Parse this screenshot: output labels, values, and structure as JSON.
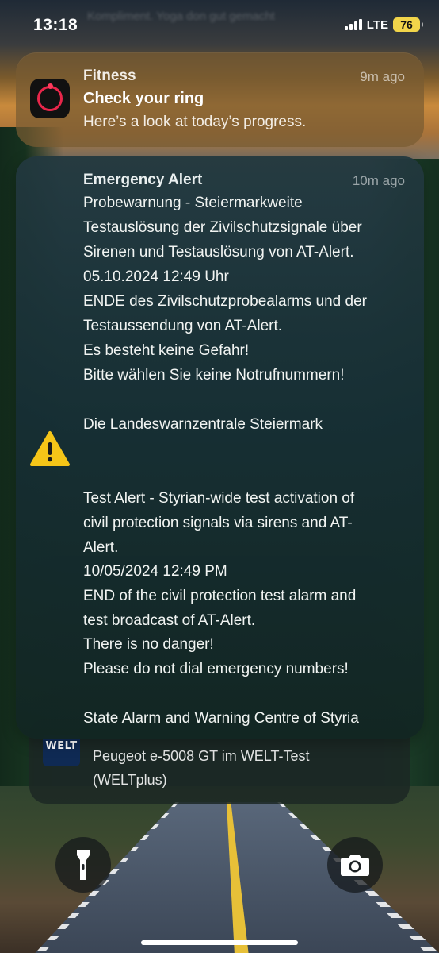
{
  "status_bar": {
    "time": "13:18",
    "network": "LTE",
    "battery": "76",
    "behind_text": "Kompliment. Yoga don gut gemacht"
  },
  "fitness": {
    "app_name": "Fitness",
    "time": "9m ago",
    "title": "Check your ring",
    "body": "Here’s a look at today’s progress."
  },
  "emergency": {
    "app_name": "Emergency Alert",
    "time": "10m ago",
    "lines": [
      "Probewarnung - Steiermarkweite",
      "Testauslösung der Zivilschutzsignale über",
      "Sirenen und Testauslösung von AT-Alert.",
      "05.10.2024 12:49 Uhr",
      "ENDE des Zivilschutzprobealarms und der",
      "Testaussendung von AT-Alert.",
      "Es besteht keine Gefahr!",
      "Bitte wählen Sie keine Notrufnummern!",
      "",
      "Die Landeswarnzentrale Steiermark",
      "",
      "",
      "Test Alert - Styrian-wide test activation of",
      "civil protection signals via sirens and AT-",
      "Alert.",
      "10/05/2024 12:49 PM",
      "END of the civil protection test alarm and",
      "test broadcast of AT-Alert.",
      "There is no danger!",
      "Please do not dial emergency numbers!",
      "",
      "State Alarm and Warning Centre of Styria"
    ]
  },
  "welt": {
    "app_icon_text": "WELT",
    "line1": "Peugeot e-5008 GT im WELT-Test",
    "line2": "(WELTplus)"
  },
  "icons": {
    "fitness": "activity-ring-icon",
    "emergency": "warning-triangle-icon",
    "flashlight": "flashlight-icon",
    "camera": "camera-icon"
  },
  "colors": {
    "warning_yellow": "#f5c518",
    "fitness_red": "#e8264a",
    "battery_yellow": "#f2d54a"
  }
}
